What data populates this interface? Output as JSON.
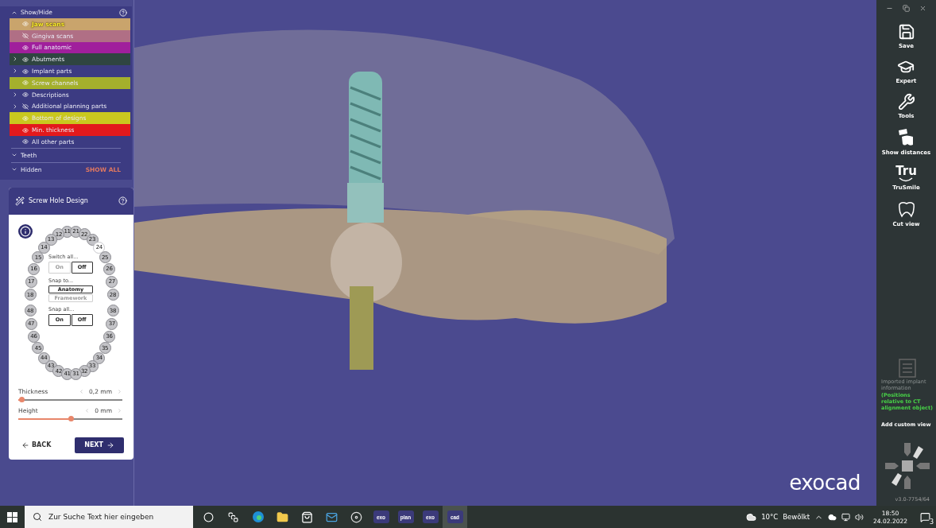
{
  "show_hide": {
    "title": "Show/Hide",
    "expanded": true,
    "items": [
      {
        "label": "Jaw scans",
        "color": "#c9a46c",
        "visible": true,
        "expandable": false,
        "selected": true
      },
      {
        "label": "Gingiva scans",
        "color": "#b06f85",
        "visible": false,
        "expandable": false,
        "selected": false
      },
      {
        "label": "Full anatomic",
        "color": "#a01f9c",
        "visible": true,
        "expandable": false,
        "selected": false
      },
      {
        "label": "Abutments",
        "color": "#2f4541",
        "visible": true,
        "expandable": true,
        "selected": false
      },
      {
        "label": "Implant parts",
        "visible": true,
        "expandable": true,
        "selected": false
      },
      {
        "label": "Screw channels",
        "color": "#a4b02c",
        "visible": true,
        "expandable": false,
        "selected": false
      },
      {
        "label": "Descriptions",
        "visible": true,
        "expandable": true,
        "selected": false
      },
      {
        "label": "Additional planning parts",
        "visible": false,
        "expandable": true,
        "selected": false
      },
      {
        "label": "Bottom of designs",
        "color": "#c9c81f",
        "visible": true,
        "expandable": false,
        "selected": false
      },
      {
        "label": "Min. thickness",
        "color": "#e3191c",
        "visible": true,
        "expandable": false,
        "selected": false
      },
      {
        "label": "All other parts",
        "visible": true,
        "expandable": false,
        "selected": false
      }
    ],
    "sections": [
      {
        "label": "Teeth",
        "expanded": false
      },
      {
        "label": "Hidden",
        "expanded": false,
        "action": "SHOW ALL"
      }
    ]
  },
  "screw_hole_design": {
    "title": "Screw Hole Design",
    "quadrants": [
      {
        "teeth": [
          {
            "number": "11",
            "selected": false
          },
          {
            "number": "12",
            "selected": false
          },
          {
            "number": "13",
            "selected": false
          },
          {
            "number": "14",
            "selected": false
          },
          {
            "number": "15",
            "selected": false
          },
          {
            "number": "16",
            "selected": false
          },
          {
            "number": "17",
            "selected": false
          },
          {
            "number": "18",
            "selected": false
          }
        ]
      },
      {
        "teeth": [
          {
            "number": "21",
            "selected": false
          },
          {
            "number": "22",
            "selected": false
          },
          {
            "number": "23",
            "selected": false
          },
          {
            "number": "24",
            "selected": true
          },
          {
            "number": "25",
            "selected": false
          },
          {
            "number": "26",
            "selected": false
          },
          {
            "number": "27",
            "selected": false
          },
          {
            "number": "28",
            "selected": false
          }
        ]
      },
      {
        "teeth": [
          {
            "number": "48",
            "selected": false
          },
          {
            "number": "47",
            "selected": false
          },
          {
            "number": "46",
            "selected": false
          },
          {
            "number": "45",
            "selected": false
          },
          {
            "number": "44",
            "selected": false
          },
          {
            "number": "43",
            "selected": false
          },
          {
            "number": "42",
            "selected": false
          },
          {
            "number": "41",
            "selected": false
          }
        ]
      },
      {
        "teeth": [
          {
            "number": "38",
            "selected": false
          },
          {
            "number": "37",
            "selected": false
          },
          {
            "number": "36",
            "selected": false
          },
          {
            "number": "35",
            "selected": false
          },
          {
            "number": "34",
            "selected": false
          },
          {
            "number": "33",
            "selected": false
          },
          {
            "number": "32",
            "selected": false
          },
          {
            "number": "31",
            "selected": false
          }
        ]
      }
    ],
    "groups": [
      {
        "label": "Switch all...",
        "kind": "row",
        "buttons": [
          {
            "label": "On",
            "disabled": true
          },
          {
            "label": "Off",
            "disabled": false
          }
        ]
      },
      {
        "label": "Snap to...",
        "kind": "column",
        "buttons": [
          {
            "label": "Anatomy",
            "disabled": false
          },
          {
            "label": "Framework",
            "disabled": true
          }
        ]
      },
      {
        "label": "Snap all...",
        "kind": "row",
        "buttons": [
          {
            "label": "On",
            "disabled": false
          },
          {
            "label": "Off",
            "disabled": false
          }
        ]
      }
    ],
    "sliders": [
      {
        "label": "Thickness",
        "value": "0,2 mm",
        "level": 0.03
      },
      {
        "label": "Height",
        "value": "0 mm",
        "level": 0.5
      }
    ],
    "back": "BACK",
    "next": "NEXT"
  },
  "viewport": {
    "logo": "exocad"
  },
  "toolbar": {
    "tools": [
      {
        "label": "Save",
        "kind": "save"
      },
      {
        "label": "Expert",
        "kind": "expert"
      },
      {
        "label": "Tools",
        "kind": "tools"
      },
      {
        "label": "Show distances",
        "kind": "distances"
      },
      {
        "label": "TruSmile",
        "kind": "trusmile",
        "icon_text": "Tru"
      },
      {
        "label": "Cut view",
        "kind": "cut"
      }
    ],
    "imported_info": {
      "label": "Imported implant information",
      "disabled": true,
      "note": "(Positions relative to CT alignment object)"
    },
    "add_custom_view": "Add custom view",
    "version": "v3.0-7754/64"
  },
  "taskbar": {
    "search": {
      "placeholder": "Zur Suche Text hier eingeben"
    },
    "apps": [
      {
        "kind": "cortana",
        "active": false
      },
      {
        "kind": "task-view",
        "active": false
      },
      {
        "kind": "browser",
        "active": false
      },
      {
        "kind": "folder",
        "active": false
      },
      {
        "kind": "store",
        "active": false
      },
      {
        "kind": "mail",
        "active": false
      },
      {
        "kind": "disc",
        "active": false
      },
      {
        "kind": "labeled",
        "text": "exo",
        "active": false
      },
      {
        "kind": "labeled",
        "text": "plan",
        "active": false
      },
      {
        "kind": "labeled",
        "text": "exo",
        "active": false
      },
      {
        "kind": "labeled",
        "text": "cad",
        "active": true
      }
    ],
    "weather": {
      "temp": "10°C",
      "text": "Bewölkt"
    },
    "time": "18:50",
    "date": "24.02.2022",
    "notifications": "3"
  }
}
